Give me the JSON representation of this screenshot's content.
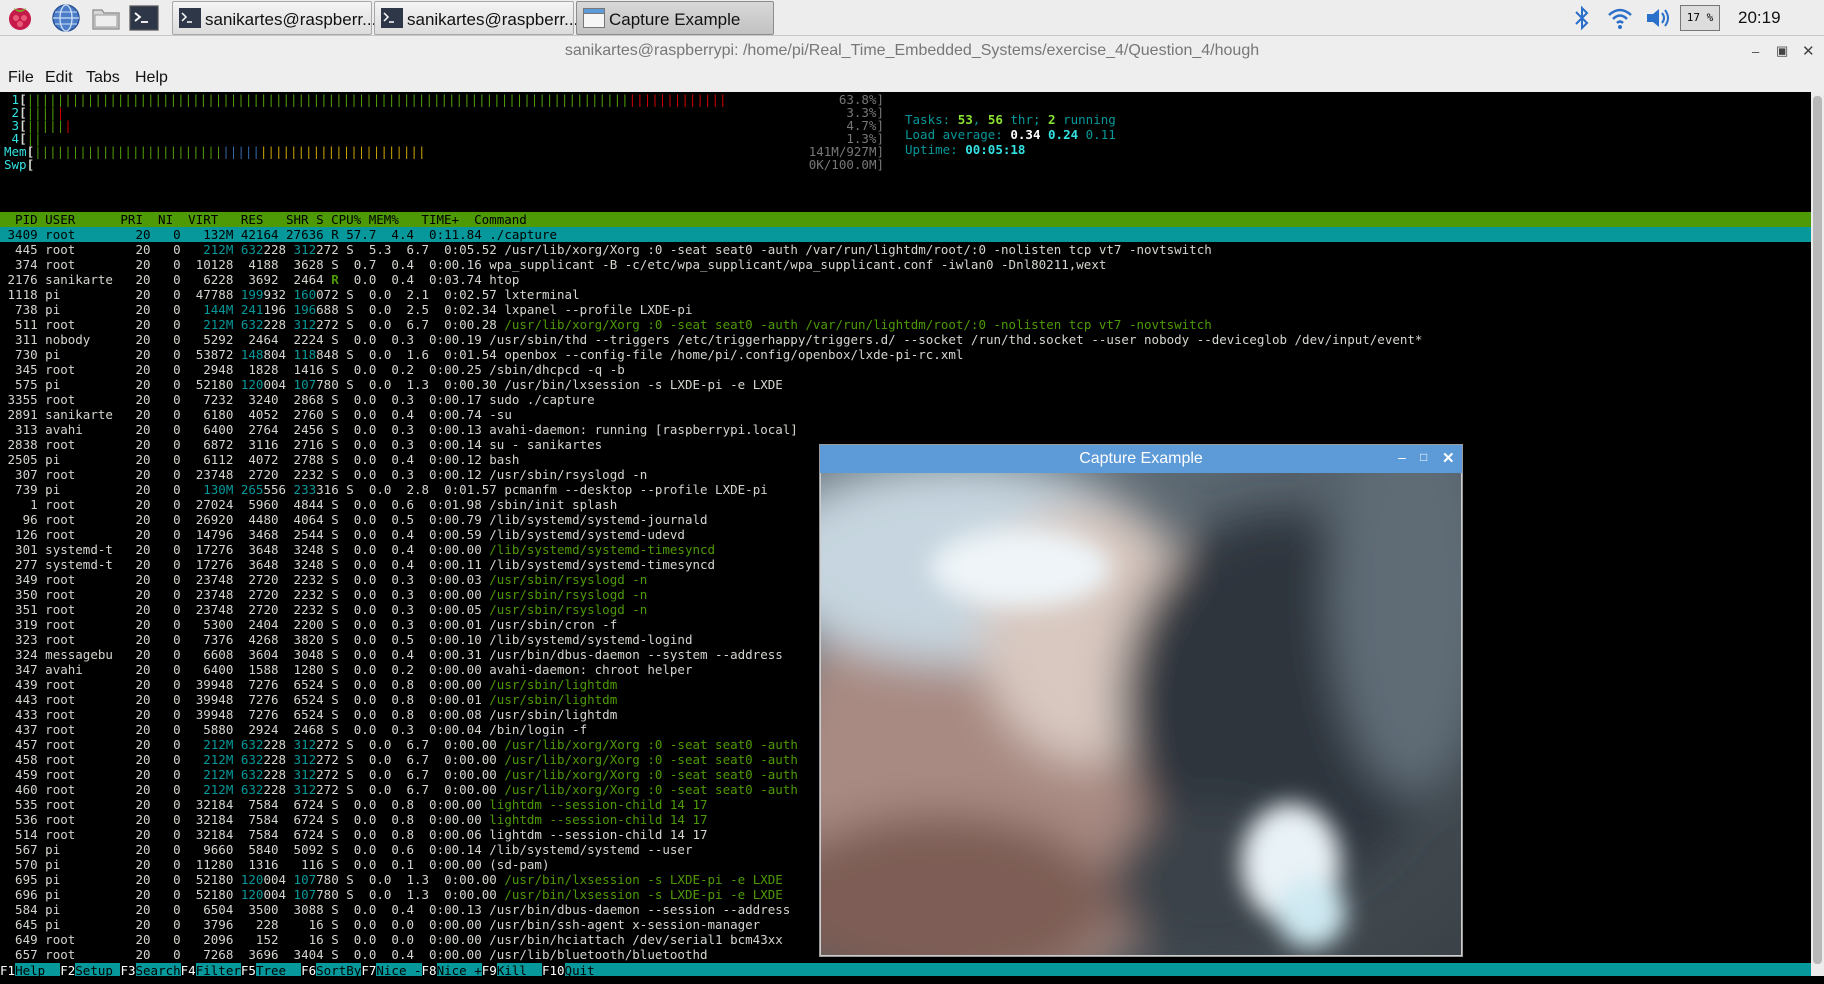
{
  "taskbar": {
    "buttons": [
      {
        "label": "sanikartes@raspberr..."
      },
      {
        "label": "sanikartes@raspberr..."
      },
      {
        "label": "Capture Example"
      }
    ],
    "cpu_percent": "17 %",
    "clock": "20:19"
  },
  "terminal_window": {
    "title": "sanikartes@raspberrypi: /home/pi/Real_Time_Embedded_Systems/exercise_4/Question_4/hough",
    "menu": [
      "File",
      "Edit",
      "Tabs",
      "Help"
    ]
  },
  "htop": {
    "meters": [
      {
        "label": "1",
        "bar": "|||||||||||||||||||||||||||||||||||||||||||||||||||||||||||||||||||||||||||||||||||||||||||||",
        "value": "63.8%"
      },
      {
        "label": "2",
        "bar": "|||||",
        "value": "3.3%"
      },
      {
        "label": "3",
        "bar": "||||||",
        "value": "4.7%"
      },
      {
        "label": "4",
        "bar": "||",
        "value": "1.3%"
      },
      {
        "label": "Mem",
        "bar": "||||||||||||||||||||||||||||||||||||||||||||||||||||",
        "value": "141M/927M"
      },
      {
        "label": "Swp",
        "bar": "",
        "value": "0K/100.0M"
      }
    ],
    "colors": {
      "green": "#4e9a06",
      "red": "#cc0000",
      "blue": "#3465a4",
      "cyan": "#06989a",
      "label": "#34e2e2"
    },
    "tasks": {
      "label": "Tasks:",
      "tasks": "53",
      "thr": "56",
      "thr_label": "thr;",
      "running": "2",
      "running_label": "running"
    },
    "load": {
      "label": "Load average:",
      "l1": "0.34",
      "l5": "0.24",
      "l15": "0.11"
    },
    "uptime": {
      "label": "Uptime:",
      "value": "00:05:18"
    },
    "header": "  PID USER      PRI  NI  VIRT   RES   SHR S CPU% MEM%   TIME+  Command",
    "rows": [
      {
        "pid": "3409",
        "user": "root",
        "pri": "20",
        "ni": "0",
        "virt": "132M",
        "res": "42164",
        "shr": "27636",
        "s": "R",
        "cpu": "57.7",
        "mem": "4.4",
        "time": "0:11.84",
        "cmd": "./capture",
        "thread": false
      },
      {
        "pid": "445",
        "user": "root",
        "pri": "20",
        "ni": "0",
        "virt": "212M",
        "res": "63228",
        "shr": "31272",
        "s": "S",
        "cpu": "5.3",
        "mem": "6.7",
        "time": "0:05.52",
        "cmd": "/usr/lib/xorg/Xorg :0 -seat seat0 -auth /var/run/lightdm/root/:0 -nolisten tcp vt7 -novtswitch",
        "thread": false
      },
      {
        "pid": "374",
        "user": "root",
        "pri": "20",
        "ni": "0",
        "virt": "10128",
        "res": "4188",
        "shr": "3628",
        "s": "S",
        "cpu": "0.7",
        "mem": "0.4",
        "time": "0:00.16",
        "cmd": "wpa_supplicant -B -c/etc/wpa_supplicant/wpa_supplicant.conf -iwlan0 -Dnl80211,wext",
        "thread": false
      },
      {
        "pid": "2176",
        "user": "sanikarte",
        "pri": "20",
        "ni": "0",
        "virt": "6228",
        "res": "3692",
        "shr": "2464",
        "s": "R",
        "cpu": "0.0",
        "mem": "0.4",
        "time": "0:03.74",
        "cmd": "htop",
        "thread": false
      },
      {
        "pid": "1118",
        "user": "pi",
        "pri": "20",
        "ni": "0",
        "virt": "47788",
        "res": "19932",
        "shr": "16072",
        "s": "S",
        "cpu": "0.0",
        "mem": "2.1",
        "time": "0:02.57",
        "cmd": "lxterminal",
        "thread": false
      },
      {
        "pid": "738",
        "user": "pi",
        "pri": "20",
        "ni": "0",
        "virt": "144M",
        "res": "24196",
        "shr": "19688",
        "s": "S",
        "cpu": "0.0",
        "mem": "2.5",
        "time": "0:02.34",
        "cmd": "lxpanel --profile LXDE-pi",
        "thread": false
      },
      {
        "pid": "511",
        "user": "root",
        "pri": "20",
        "ni": "0",
        "virt": "212M",
        "res": "63228",
        "shr": "31272",
        "s": "S",
        "cpu": "0.0",
        "mem": "6.7",
        "time": "0:00.28",
        "cmd": "/usr/lib/xorg/Xorg :0 -seat seat0 -auth /var/run/lightdm/root/:0 -nolisten tcp vt7 -novtswitch",
        "thread": true
      },
      {
        "pid": "311",
        "user": "nobody",
        "pri": "20",
        "ni": "0",
        "virt": "5292",
        "res": "2464",
        "shr": "2224",
        "s": "S",
        "cpu": "0.0",
        "mem": "0.3",
        "time": "0:00.19",
        "cmd": "/usr/sbin/thd --triggers /etc/triggerhappy/triggers.d/ --socket /run/thd.socket --user nobody --deviceglob /dev/input/event*",
        "thread": false
      },
      {
        "pid": "730",
        "user": "pi",
        "pri": "20",
        "ni": "0",
        "virt": "53872",
        "res": "14804",
        "shr": "11848",
        "s": "S",
        "cpu": "0.0",
        "mem": "1.6",
        "time": "0:01.54",
        "cmd": "openbox --config-file /home/pi/.config/openbox/lxde-pi-rc.xml",
        "thread": false
      },
      {
        "pid": "345",
        "user": "root",
        "pri": "20",
        "ni": "0",
        "virt": "2948",
        "res": "1828",
        "shr": "1416",
        "s": "S",
        "cpu": "0.0",
        "mem": "0.2",
        "time": "0:00.25",
        "cmd": "/sbin/dhcpcd -q -b",
        "thread": false
      },
      {
        "pid": "575",
        "user": "pi",
        "pri": "20",
        "ni": "0",
        "virt": "52180",
        "res": "12004",
        "shr": "10780",
        "s": "S",
        "cpu": "0.0",
        "mem": "1.3",
        "time": "0:00.30",
        "cmd": "/usr/bin/lxsession -s LXDE-pi -e LXDE",
        "thread": false
      },
      {
        "pid": "3355",
        "user": "root",
        "pri": "20",
        "ni": "0",
        "virt": "7232",
        "res": "3240",
        "shr": "2868",
        "s": "S",
        "cpu": "0.0",
        "mem": "0.3",
        "time": "0:00.17",
        "cmd": "sudo ./capture",
        "thread": false
      },
      {
        "pid": "2891",
        "user": "sanikarte",
        "pri": "20",
        "ni": "0",
        "virt": "6180",
        "res": "4052",
        "shr": "2760",
        "s": "S",
        "cpu": "0.0",
        "mem": "0.4",
        "time": "0:00.74",
        "cmd": "-su",
        "thread": false
      },
      {
        "pid": "313",
        "user": "avahi",
        "pri": "20",
        "ni": "0",
        "virt": "6400",
        "res": "2764",
        "shr": "2456",
        "s": "S",
        "cpu": "0.0",
        "mem": "0.3",
        "time": "0:00.13",
        "cmd": "avahi-daemon: running [raspberrypi.local]",
        "thread": false
      },
      {
        "pid": "2838",
        "user": "root",
        "pri": "20",
        "ni": "0",
        "virt": "6872",
        "res": "3116",
        "shr": "2716",
        "s": "S",
        "cpu": "0.0",
        "mem": "0.3",
        "time": "0:00.14",
        "cmd": "su - sanikartes",
        "thread": false
      },
      {
        "pid": "2505",
        "user": "pi",
        "pri": "20",
        "ni": "0",
        "virt": "6112",
        "res": "4072",
        "shr": "2788",
        "s": "S",
        "cpu": "0.0",
        "mem": "0.4",
        "time": "0:00.12",
        "cmd": "bash",
        "thread": false
      },
      {
        "pid": "307",
        "user": "root",
        "pri": "20",
        "ni": "0",
        "virt": "23748",
        "res": "2720",
        "shr": "2232",
        "s": "S",
        "cpu": "0.0",
        "mem": "0.3",
        "time": "0:00.12",
        "cmd": "/usr/sbin/rsyslogd -n",
        "thread": false
      },
      {
        "pid": "739",
        "user": "pi",
        "pri": "20",
        "ni": "0",
        "virt": "130M",
        "res": "26556",
        "shr": "23316",
        "s": "S",
        "cpu": "0.0",
        "mem": "2.8",
        "time": "0:01.57",
        "cmd": "pcmanfm --desktop --profile LXDE-pi",
        "thread": false
      },
      {
        "pid": "1",
        "user": "root",
        "pri": "20",
        "ni": "0",
        "virt": "27024",
        "res": "5960",
        "shr": "4844",
        "s": "S",
        "cpu": "0.0",
        "mem": "0.6",
        "time": "0:01.98",
        "cmd": "/sbin/init splash",
        "thread": false
      },
      {
        "pid": "96",
        "user": "root",
        "pri": "20",
        "ni": "0",
        "virt": "26920",
        "res": "4480",
        "shr": "4064",
        "s": "S",
        "cpu": "0.0",
        "mem": "0.5",
        "time": "0:00.79",
        "cmd": "/lib/systemd/systemd-journald",
        "thread": false
      },
      {
        "pid": "126",
        "user": "root",
        "pri": "20",
        "ni": "0",
        "virt": "14796",
        "res": "3468",
        "shr": "2544",
        "s": "S",
        "cpu": "0.0",
        "mem": "0.4",
        "time": "0:00.59",
        "cmd": "/lib/systemd/systemd-udevd",
        "thread": false
      },
      {
        "pid": "301",
        "user": "systemd-t",
        "pri": "20",
        "ni": "0",
        "virt": "17276",
        "res": "3648",
        "shr": "3248",
        "s": "S",
        "cpu": "0.0",
        "mem": "0.4",
        "time": "0:00.00",
        "cmd": "/lib/systemd/systemd-timesyncd",
        "thread": true
      },
      {
        "pid": "277",
        "user": "systemd-t",
        "pri": "20",
        "ni": "0",
        "virt": "17276",
        "res": "3648",
        "shr": "3248",
        "s": "S",
        "cpu": "0.0",
        "mem": "0.4",
        "time": "0:00.11",
        "cmd": "/lib/systemd/systemd-timesyncd",
        "thread": false
      },
      {
        "pid": "349",
        "user": "root",
        "pri": "20",
        "ni": "0",
        "virt": "23748",
        "res": "2720",
        "shr": "2232",
        "s": "S",
        "cpu": "0.0",
        "mem": "0.3",
        "time": "0:00.03",
        "cmd": "/usr/sbin/rsyslogd -n",
        "thread": true
      },
      {
        "pid": "350",
        "user": "root",
        "pri": "20",
        "ni": "0",
        "virt": "23748",
        "res": "2720",
        "shr": "2232",
        "s": "S",
        "cpu": "0.0",
        "mem": "0.3",
        "time": "0:00.00",
        "cmd": "/usr/sbin/rsyslogd -n",
        "thread": true
      },
      {
        "pid": "351",
        "user": "root",
        "pri": "20",
        "ni": "0",
        "virt": "23748",
        "res": "2720",
        "shr": "2232",
        "s": "S",
        "cpu": "0.0",
        "mem": "0.3",
        "time": "0:00.05",
        "cmd": "/usr/sbin/rsyslogd -n",
        "thread": true
      },
      {
        "pid": "319",
        "user": "root",
        "pri": "20",
        "ni": "0",
        "virt": "5300",
        "res": "2404",
        "shr": "2200",
        "s": "S",
        "cpu": "0.0",
        "mem": "0.3",
        "time": "0:00.01",
        "cmd": "/usr/sbin/cron -f",
        "thread": false
      },
      {
        "pid": "323",
        "user": "root",
        "pri": "20",
        "ni": "0",
        "virt": "7376",
        "res": "4268",
        "shr": "3820",
        "s": "S",
        "cpu": "0.0",
        "mem": "0.5",
        "time": "0:00.10",
        "cmd": "/lib/systemd/systemd-logind",
        "thread": false
      },
      {
        "pid": "324",
        "user": "messagebu",
        "pri": "20",
        "ni": "0",
        "virt": "6608",
        "res": "3604",
        "shr": "3048",
        "s": "S",
        "cpu": "0.0",
        "mem": "0.4",
        "time": "0:00.31",
        "cmd": "/usr/bin/dbus-daemon --system --address",
        "thread": false
      },
      {
        "pid": "347",
        "user": "avahi",
        "pri": "20",
        "ni": "0",
        "virt": "6400",
        "res": "1588",
        "shr": "1280",
        "s": "S",
        "cpu": "0.0",
        "mem": "0.2",
        "time": "0:00.00",
        "cmd": "avahi-daemon: chroot helper",
        "thread": false
      },
      {
        "pid": "439",
        "user": "root",
        "pri": "20",
        "ni": "0",
        "virt": "39948",
        "res": "7276",
        "shr": "6524",
        "s": "S",
        "cpu": "0.0",
        "mem": "0.8",
        "time": "0:00.00",
        "cmd": "/usr/sbin/lightdm",
        "thread": true
      },
      {
        "pid": "443",
        "user": "root",
        "pri": "20",
        "ni": "0",
        "virt": "39948",
        "res": "7276",
        "shr": "6524",
        "s": "S",
        "cpu": "0.0",
        "mem": "0.8",
        "time": "0:00.01",
        "cmd": "/usr/sbin/lightdm",
        "thread": true
      },
      {
        "pid": "433",
        "user": "root",
        "pri": "20",
        "ni": "0",
        "virt": "39948",
        "res": "7276",
        "shr": "6524",
        "s": "S",
        "cpu": "0.0",
        "mem": "0.8",
        "time": "0:00.08",
        "cmd": "/usr/sbin/lightdm",
        "thread": false
      },
      {
        "pid": "437",
        "user": "root",
        "pri": "20",
        "ni": "0",
        "virt": "5880",
        "res": "2924",
        "shr": "2468",
        "s": "S",
        "cpu": "0.0",
        "mem": "0.3",
        "time": "0:00.04",
        "cmd": "/bin/login -f",
        "thread": false
      },
      {
        "pid": "457",
        "user": "root",
        "pri": "20",
        "ni": "0",
        "virt": "212M",
        "res": "63228",
        "shr": "31272",
        "s": "S",
        "cpu": "0.0",
        "mem": "6.7",
        "time": "0:00.00",
        "cmd": "/usr/lib/xorg/Xorg :0 -seat seat0 -auth",
        "thread": true
      },
      {
        "pid": "458",
        "user": "root",
        "pri": "20",
        "ni": "0",
        "virt": "212M",
        "res": "63228",
        "shr": "31272",
        "s": "S",
        "cpu": "0.0",
        "mem": "6.7",
        "time": "0:00.00",
        "cmd": "/usr/lib/xorg/Xorg :0 -seat seat0 -auth",
        "thread": true
      },
      {
        "pid": "459",
        "user": "root",
        "pri": "20",
        "ni": "0",
        "virt": "212M",
        "res": "63228",
        "shr": "31272",
        "s": "S",
        "cpu": "0.0",
        "mem": "6.7",
        "time": "0:00.00",
        "cmd": "/usr/lib/xorg/Xorg :0 -seat seat0 -auth",
        "thread": true
      },
      {
        "pid": "460",
        "user": "root",
        "pri": "20",
        "ni": "0",
        "virt": "212M",
        "res": "63228",
        "shr": "31272",
        "s": "S",
        "cpu": "0.0",
        "mem": "6.7",
        "time": "0:00.00",
        "cmd": "/usr/lib/xorg/Xorg :0 -seat seat0 -auth",
        "thread": true
      },
      {
        "pid": "535",
        "user": "root",
        "pri": "20",
        "ni": "0",
        "virt": "32184",
        "res": "7584",
        "shr": "6724",
        "s": "S",
        "cpu": "0.0",
        "mem": "0.8",
        "time": "0:00.00",
        "cmd": "lightdm --session-child 14 17",
        "thread": true
      },
      {
        "pid": "536",
        "user": "root",
        "pri": "20",
        "ni": "0",
        "virt": "32184",
        "res": "7584",
        "shr": "6724",
        "s": "S",
        "cpu": "0.0",
        "mem": "0.8",
        "time": "0:00.00",
        "cmd": "lightdm --session-child 14 17",
        "thread": true
      },
      {
        "pid": "514",
        "user": "root",
        "pri": "20",
        "ni": "0",
        "virt": "32184",
        "res": "7584",
        "shr": "6724",
        "s": "S",
        "cpu": "0.0",
        "mem": "0.8",
        "time": "0:00.06",
        "cmd": "lightdm --session-child 14 17",
        "thread": false
      },
      {
        "pid": "567",
        "user": "pi",
        "pri": "20",
        "ni": "0",
        "virt": "9660",
        "res": "5840",
        "shr": "5092",
        "s": "S",
        "cpu": "0.0",
        "mem": "0.6",
        "time": "0:00.14",
        "cmd": "/lib/systemd/systemd --user",
        "thread": false
      },
      {
        "pid": "570",
        "user": "pi",
        "pri": "20",
        "ni": "0",
        "virt": "11280",
        "res": "1316",
        "shr": "116",
        "s": "S",
        "cpu": "0.0",
        "mem": "0.1",
        "time": "0:00.00",
        "cmd": "(sd-pam)",
        "thread": false
      },
      {
        "pid": "695",
        "user": "pi",
        "pri": "20",
        "ni": "0",
        "virt": "52180",
        "res": "12004",
        "shr": "10780",
        "s": "S",
        "cpu": "0.0",
        "mem": "1.3",
        "time": "0:00.00",
        "cmd": "/usr/bin/lxsession -s LXDE-pi -e LXDE",
        "thread": true
      },
      {
        "pid": "696",
        "user": "pi",
        "pri": "20",
        "ni": "0",
        "virt": "52180",
        "res": "12004",
        "shr": "10780",
        "s": "S",
        "cpu": "0.0",
        "mem": "1.3",
        "time": "0:00.00",
        "cmd": "/usr/bin/lxsession -s LXDE-pi -e LXDE",
        "thread": true
      },
      {
        "pid": "584",
        "user": "pi",
        "pri": "20",
        "ni": "0",
        "virt": "6504",
        "res": "3500",
        "shr": "3088",
        "s": "S",
        "cpu": "0.0",
        "mem": "0.4",
        "time": "0:00.13",
        "cmd": "/usr/bin/dbus-daemon --session --address",
        "thread": false
      },
      {
        "pid": "645",
        "user": "pi",
        "pri": "20",
        "ni": "0",
        "virt": "3796",
        "res": "228",
        "shr": "16",
        "s": "S",
        "cpu": "0.0",
        "mem": "0.0",
        "time": "0:00.00",
        "cmd": "/usr/bin/ssh-agent x-session-manager",
        "thread": false
      },
      {
        "pid": "649",
        "user": "root",
        "pri": "20",
        "ni": "0",
        "virt": "2096",
        "res": "152",
        "shr": "16",
        "s": "S",
        "cpu": "0.0",
        "mem": "0.0",
        "time": "0:00.00",
        "cmd": "/usr/bin/hciattach /dev/serial1 bcm43xx",
        "thread": false
      },
      {
        "pid": "657",
        "user": "root",
        "pri": "20",
        "ni": "0",
        "virt": "7268",
        "res": "3696",
        "shr": "3404",
        "s": "S",
        "cpu": "0.0",
        "mem": "0.4",
        "time": "0:00.00",
        "cmd": "/usr/lib/bluetooth/bluetoothd",
        "thread": false
      }
    ],
    "fkeys": [
      {
        "key": "F1",
        "label": "Help  "
      },
      {
        "key": "F2",
        "label": "Setup "
      },
      {
        "key": "F3",
        "label": "Search"
      },
      {
        "key": "F4",
        "label": "Filter"
      },
      {
        "key": "F5",
        "label": "Tree  "
      },
      {
        "key": "F6",
        "label": "SortBy"
      },
      {
        "key": "F7",
        "label": "Nice -"
      },
      {
        "key": "F8",
        "label": "Nice +"
      },
      {
        "key": "F9",
        "label": "Kill  "
      },
      {
        "key": "F10",
        "label": "Quit  "
      }
    ]
  },
  "capture_window": {
    "title": "Capture Example",
    "colors": {
      "titlebar": "#5c9ad8"
    }
  }
}
